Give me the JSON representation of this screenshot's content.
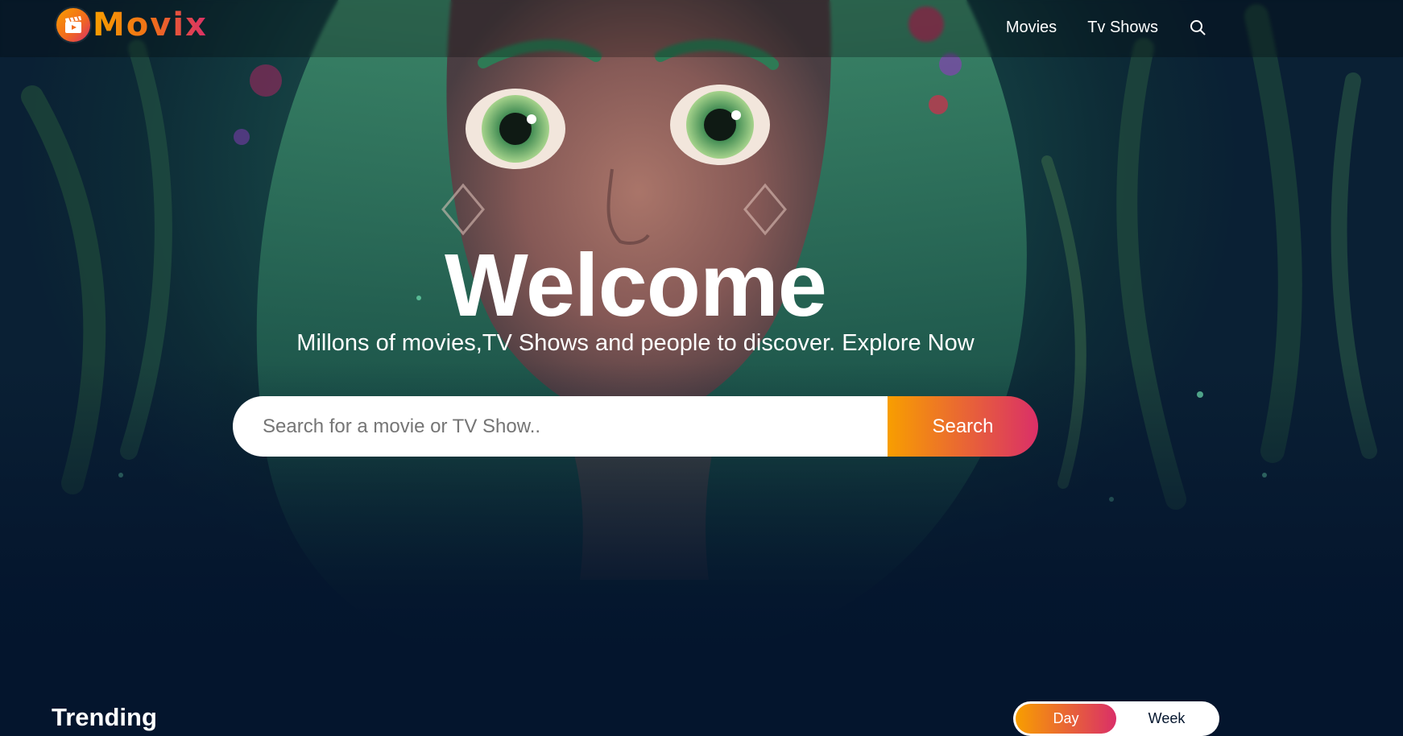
{
  "brand": {
    "name": "Movix",
    "accent_start": "#f89e00",
    "accent_end": "#da2f68",
    "background": "#04152d"
  },
  "nav": {
    "items": [
      {
        "label": "Movies"
      },
      {
        "label": "Tv Shows"
      }
    ],
    "search_icon": "search-icon"
  },
  "hero": {
    "title": "Welcome",
    "subtitle": "Millons of movies,TV Shows and people to discover. Explore Now",
    "search": {
      "placeholder": "Search for a movie or TV Show..",
      "value": "",
      "button_label": "Search"
    }
  },
  "trending": {
    "title": "Trending",
    "tabs": [
      {
        "label": "Day",
        "active": true
      },
      {
        "label": "Week",
        "active": false
      }
    ]
  }
}
